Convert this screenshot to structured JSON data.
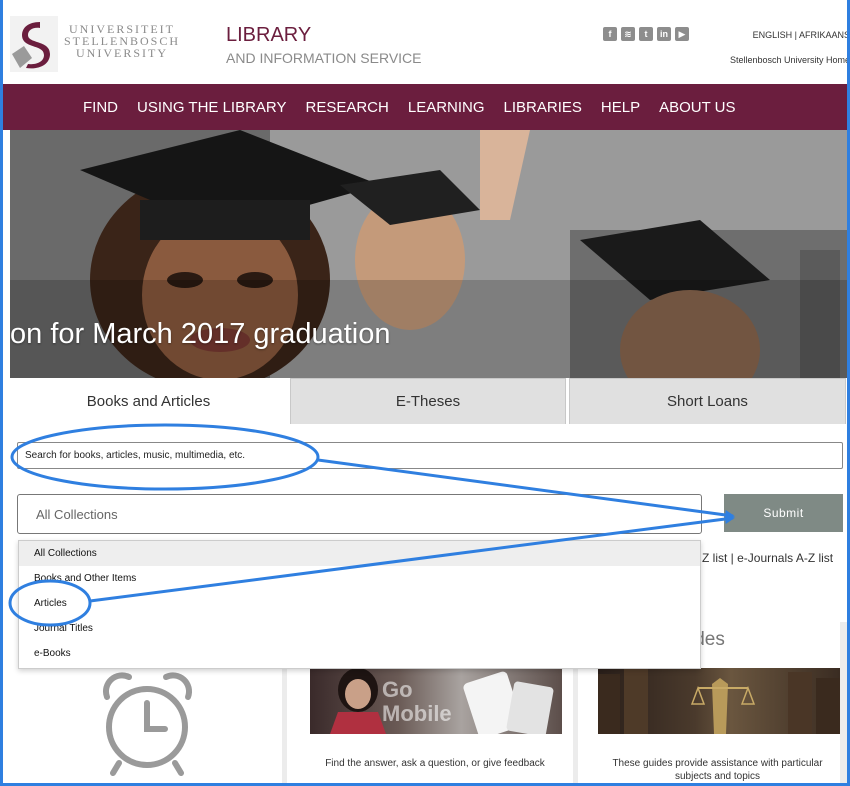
{
  "header": {
    "university_lines": [
      "UNIVERSITEIT",
      "STELLENBOSCH",
      "UNIVERSITY"
    ],
    "library_title": "LIBRARY",
    "library_subtitle": "AND INFORMATION SERVICE",
    "social_icons": [
      "facebook-icon",
      "rss-icon",
      "twitter-icon",
      "linkedin-icon",
      "youtube-icon"
    ],
    "language_links": "ENGLISH | AFRIKAANS",
    "home_link": "Stellenbosch University Home"
  },
  "nav": {
    "items": [
      "FIND",
      "USING THE LIBRARY",
      "RESEARCH",
      "LEARNING",
      "LIBRARIES",
      "HELP",
      "ABOUT US"
    ]
  },
  "hero": {
    "caption": "on for March 2017 graduation"
  },
  "tabs": [
    "Books and Articles",
    "E-Theses",
    "Short Loans"
  ],
  "search": {
    "placeholder": "Search for books, articles, music, multimedia, etc.",
    "collection_value": "All Collections",
    "submit_label": "Submit",
    "az_links": "Z list | e-Journals A-Z list"
  },
  "dropdown": {
    "options": [
      "All Collections",
      "Books and Other Items",
      "Articles",
      "Journal Titles",
      "e-Books"
    ],
    "selected_index": 0
  },
  "cards": {
    "guides_heading": "ides",
    "mobile_img_text": "Go Mobile",
    "help_text": "Find the answer, ask a question, or give feedback",
    "guides_text": "These guides provide assistance with particular subjects and topics"
  },
  "colors": {
    "brand": "#6b1e3e",
    "submit": "#7f8a85",
    "annotation": "#2f7fe0"
  }
}
